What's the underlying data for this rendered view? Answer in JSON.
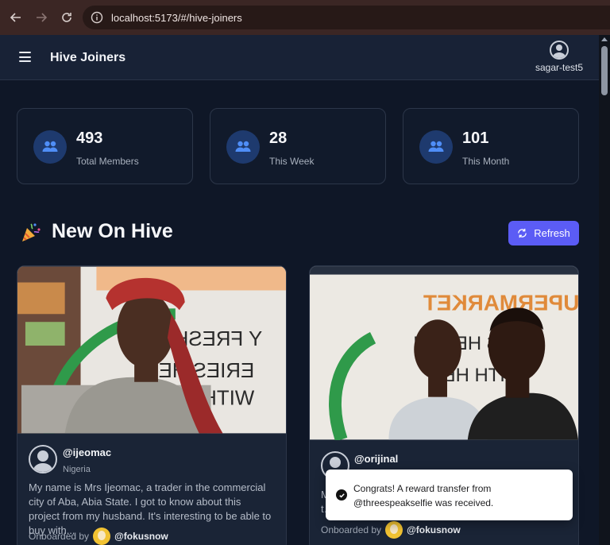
{
  "browser": {
    "url": "localhost:5173/#/hive-joiners",
    "back_icon": "arrow-left-icon",
    "forward_icon": "arrow-right-icon",
    "reload_icon": "reload-icon",
    "site_info_icon": "info-icon"
  },
  "header": {
    "menu_icon": "hamburger-icon",
    "title": "Hive Joiners",
    "user": {
      "name": "sagar-test5",
      "icon": "user-circle-icon"
    }
  },
  "stats": [
    {
      "value": "493",
      "label": "Total Members",
      "icon": "users-icon"
    },
    {
      "value": "28",
      "label": "This Week",
      "icon": "users-icon"
    },
    {
      "value": "101",
      "label": "This Month",
      "icon": "users-icon"
    }
  ],
  "section": {
    "emoji": "🎉",
    "title": "New On Hive",
    "refresh_label": "Refresh",
    "refresh_icon": "refresh-icon"
  },
  "cards": [
    {
      "handle": "@ijeomac",
      "country": "Nigeria",
      "description": "My name is Mrs Ijeomac, a trader in the commercial city of Aba, Abia State. I got to know about this project from my husband. It's interesting to be able to buy with...",
      "onboarded_label": "Onboarded by",
      "onboarded_by": "@fokusnow"
    },
    {
      "handle": "@orijinal",
      "country": "",
      "description": "M… t…",
      "onboarded_label": "Onboarded by",
      "onboarded_by": "@fokusnow"
    }
  ],
  "toast": {
    "message": "Congrats! A reward transfer from @threespeakselfie was received.",
    "icon": "check-circle-icon"
  },
  "colors": {
    "accent": "#5b5cf5",
    "stat_icon_bg": "#1e3a6e",
    "stat_icon_fg": "#4f8ef7",
    "page_bg": "#0f1727",
    "card_bg": "#1a2436"
  }
}
